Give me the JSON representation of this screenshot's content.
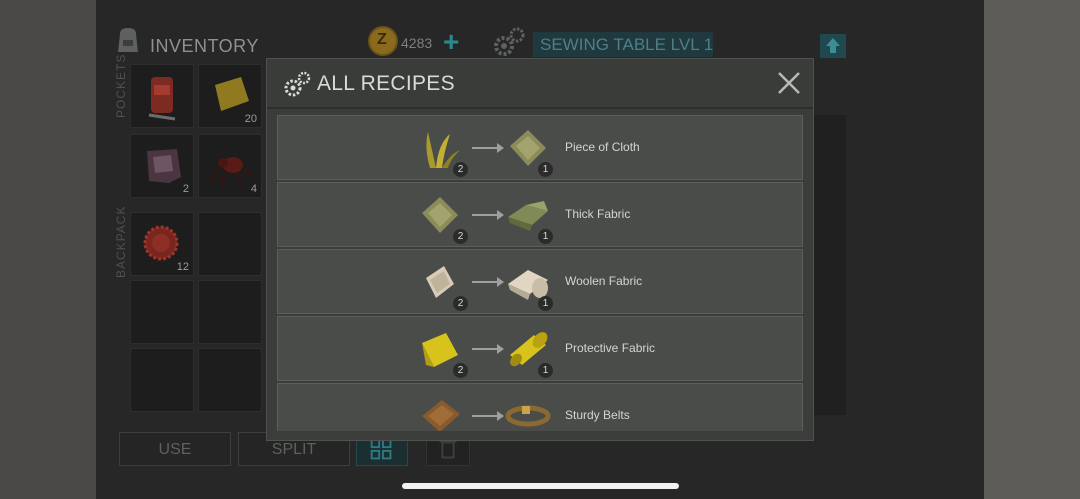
{
  "inventory": {
    "title": "INVENTORY",
    "coins": "4283",
    "station": "SEWING TABLE LVL 1",
    "pockets_label": "POCKETS",
    "backpack_label": "BACKPACK",
    "pocket_slots": [
      {
        "item": "backpack-item",
        "count": ""
      },
      {
        "item": "cloth-piece",
        "count": "20"
      },
      {
        "item": "hide",
        "count": "2"
      },
      {
        "item": "spider",
        "count": "4"
      }
    ],
    "backpack_slots": [
      {
        "item": "bottle-cap",
        "count": "12"
      }
    ],
    "buttons": {
      "use": "USE",
      "split": "SPLIT"
    }
  },
  "modal": {
    "title": "ALL RECIPES",
    "recipes": [
      {
        "input_icon": "grass-icon",
        "input_qty": "2",
        "output_icon": "cloth-icon",
        "output_qty": "1",
        "name": "Piece of Cloth"
      },
      {
        "input_icon": "cloth-icon",
        "input_qty": "2",
        "output_icon": "thick-fabric-icon",
        "output_qty": "1",
        "name": "Thick Fabric"
      },
      {
        "input_icon": "wool-icon",
        "input_qty": "2",
        "output_icon": "woolen-fabric-icon",
        "output_qty": "1",
        "name": "Woolen Fabric"
      },
      {
        "input_icon": "yellow-cloth-icon",
        "input_qty": "2",
        "output_icon": "protective-fabric-icon",
        "output_qty": "1",
        "name": "Protective Fabric"
      },
      {
        "input_icon": "leather-icon",
        "input_qty": "",
        "output_icon": "belts-icon",
        "output_qty": "",
        "name": "Sturdy Belts"
      }
    ]
  },
  "colors": {
    "accent": "#2a8a92",
    "station_bg": "#20393e"
  }
}
